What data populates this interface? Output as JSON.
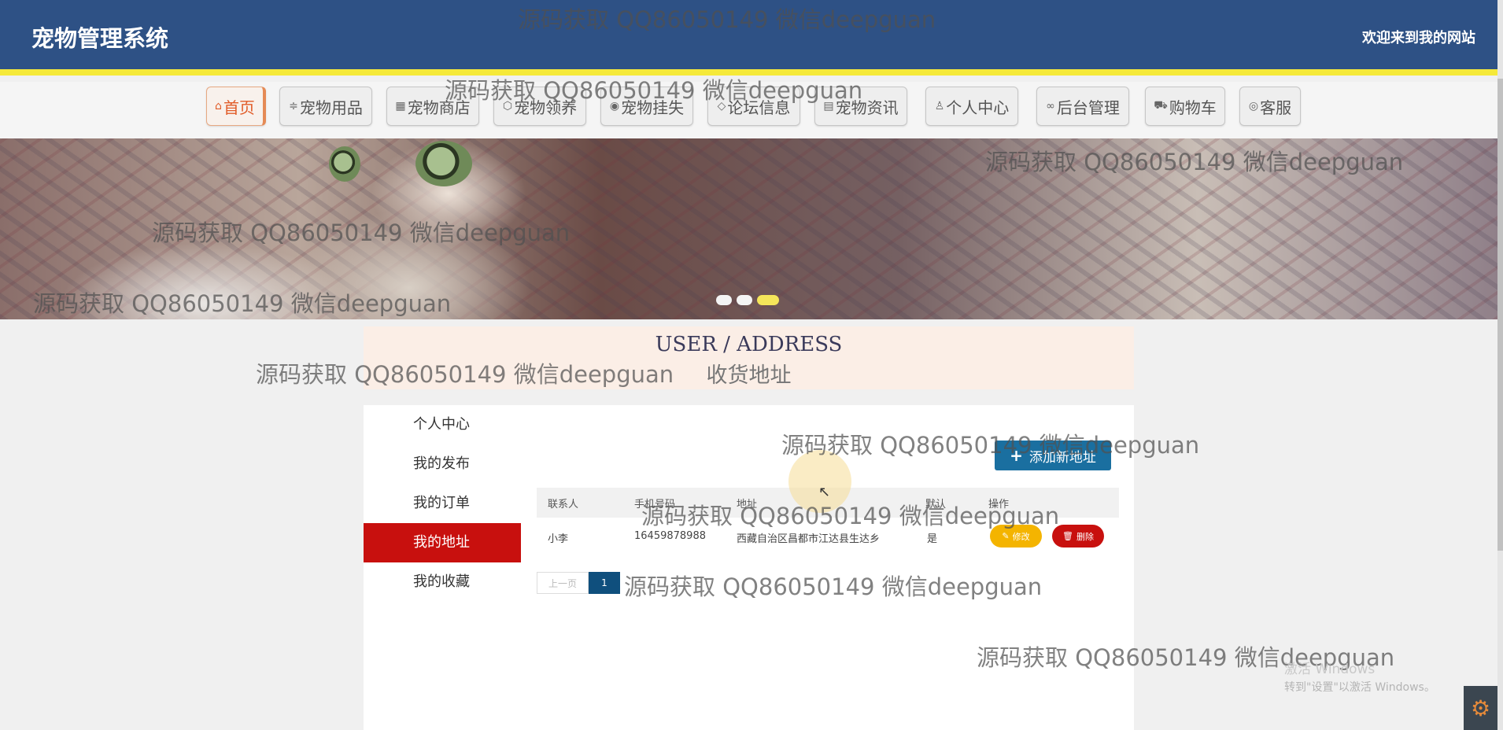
{
  "header": {
    "site_title": "宠物管理系统",
    "welcome": "欢迎来到我的网站"
  },
  "nav": [
    {
      "label": "首页",
      "icon": "home-icon"
    },
    {
      "label": "宠物用品",
      "icon": "sliders-icon"
    },
    {
      "label": "宠物商店",
      "icon": "store-icon"
    },
    {
      "label": "宠物领养",
      "icon": "box-icon"
    },
    {
      "label": "宠物挂失",
      "icon": "paw-icon"
    },
    {
      "label": "论坛信息",
      "icon": "tag-icon"
    },
    {
      "label": "宠物资讯",
      "icon": "news-icon"
    },
    {
      "label": "个人中心",
      "icon": "user-icon"
    },
    {
      "label": "后台管理",
      "icon": "link-icon"
    },
    {
      "label": "购物车",
      "icon": "cart-icon"
    },
    {
      "label": "客服",
      "icon": "support-icon"
    }
  ],
  "section": {
    "title_en": "USER / ADDRESS",
    "title_cn": "收货地址"
  },
  "sidebar": [
    {
      "label": "个人中心"
    },
    {
      "label": "我的发布"
    },
    {
      "label": "我的订单"
    },
    {
      "label": "我的地址"
    },
    {
      "label": "我的收藏"
    }
  ],
  "sidebar_active": "我的地址",
  "add_button": "添加新地址",
  "table": {
    "headers": [
      "联系人",
      "手机号码",
      "地址",
      "默认",
      "操作"
    ],
    "rows": [
      {
        "contact": "小李",
        "phone": "16459878988",
        "address": "西藏自治区昌都市江达县生达乡",
        "default": "是"
      }
    ],
    "edit_label": "修改",
    "delete_label": "删除"
  },
  "pagination": {
    "prev": "上一页",
    "current": "1"
  },
  "watermark": "源码获取 QQ86050149 微信deepguan",
  "os": {
    "activate_title": "激活 Windows",
    "activate_sub": "转到\"设置\"以激活 Windows。"
  },
  "colors": {
    "header_bg": "#2e5185",
    "accent_yellow": "#f5e93a",
    "active_red": "#c8100e",
    "add_blue": "#1a6fa0",
    "edit_yellow": "#f4b400"
  }
}
